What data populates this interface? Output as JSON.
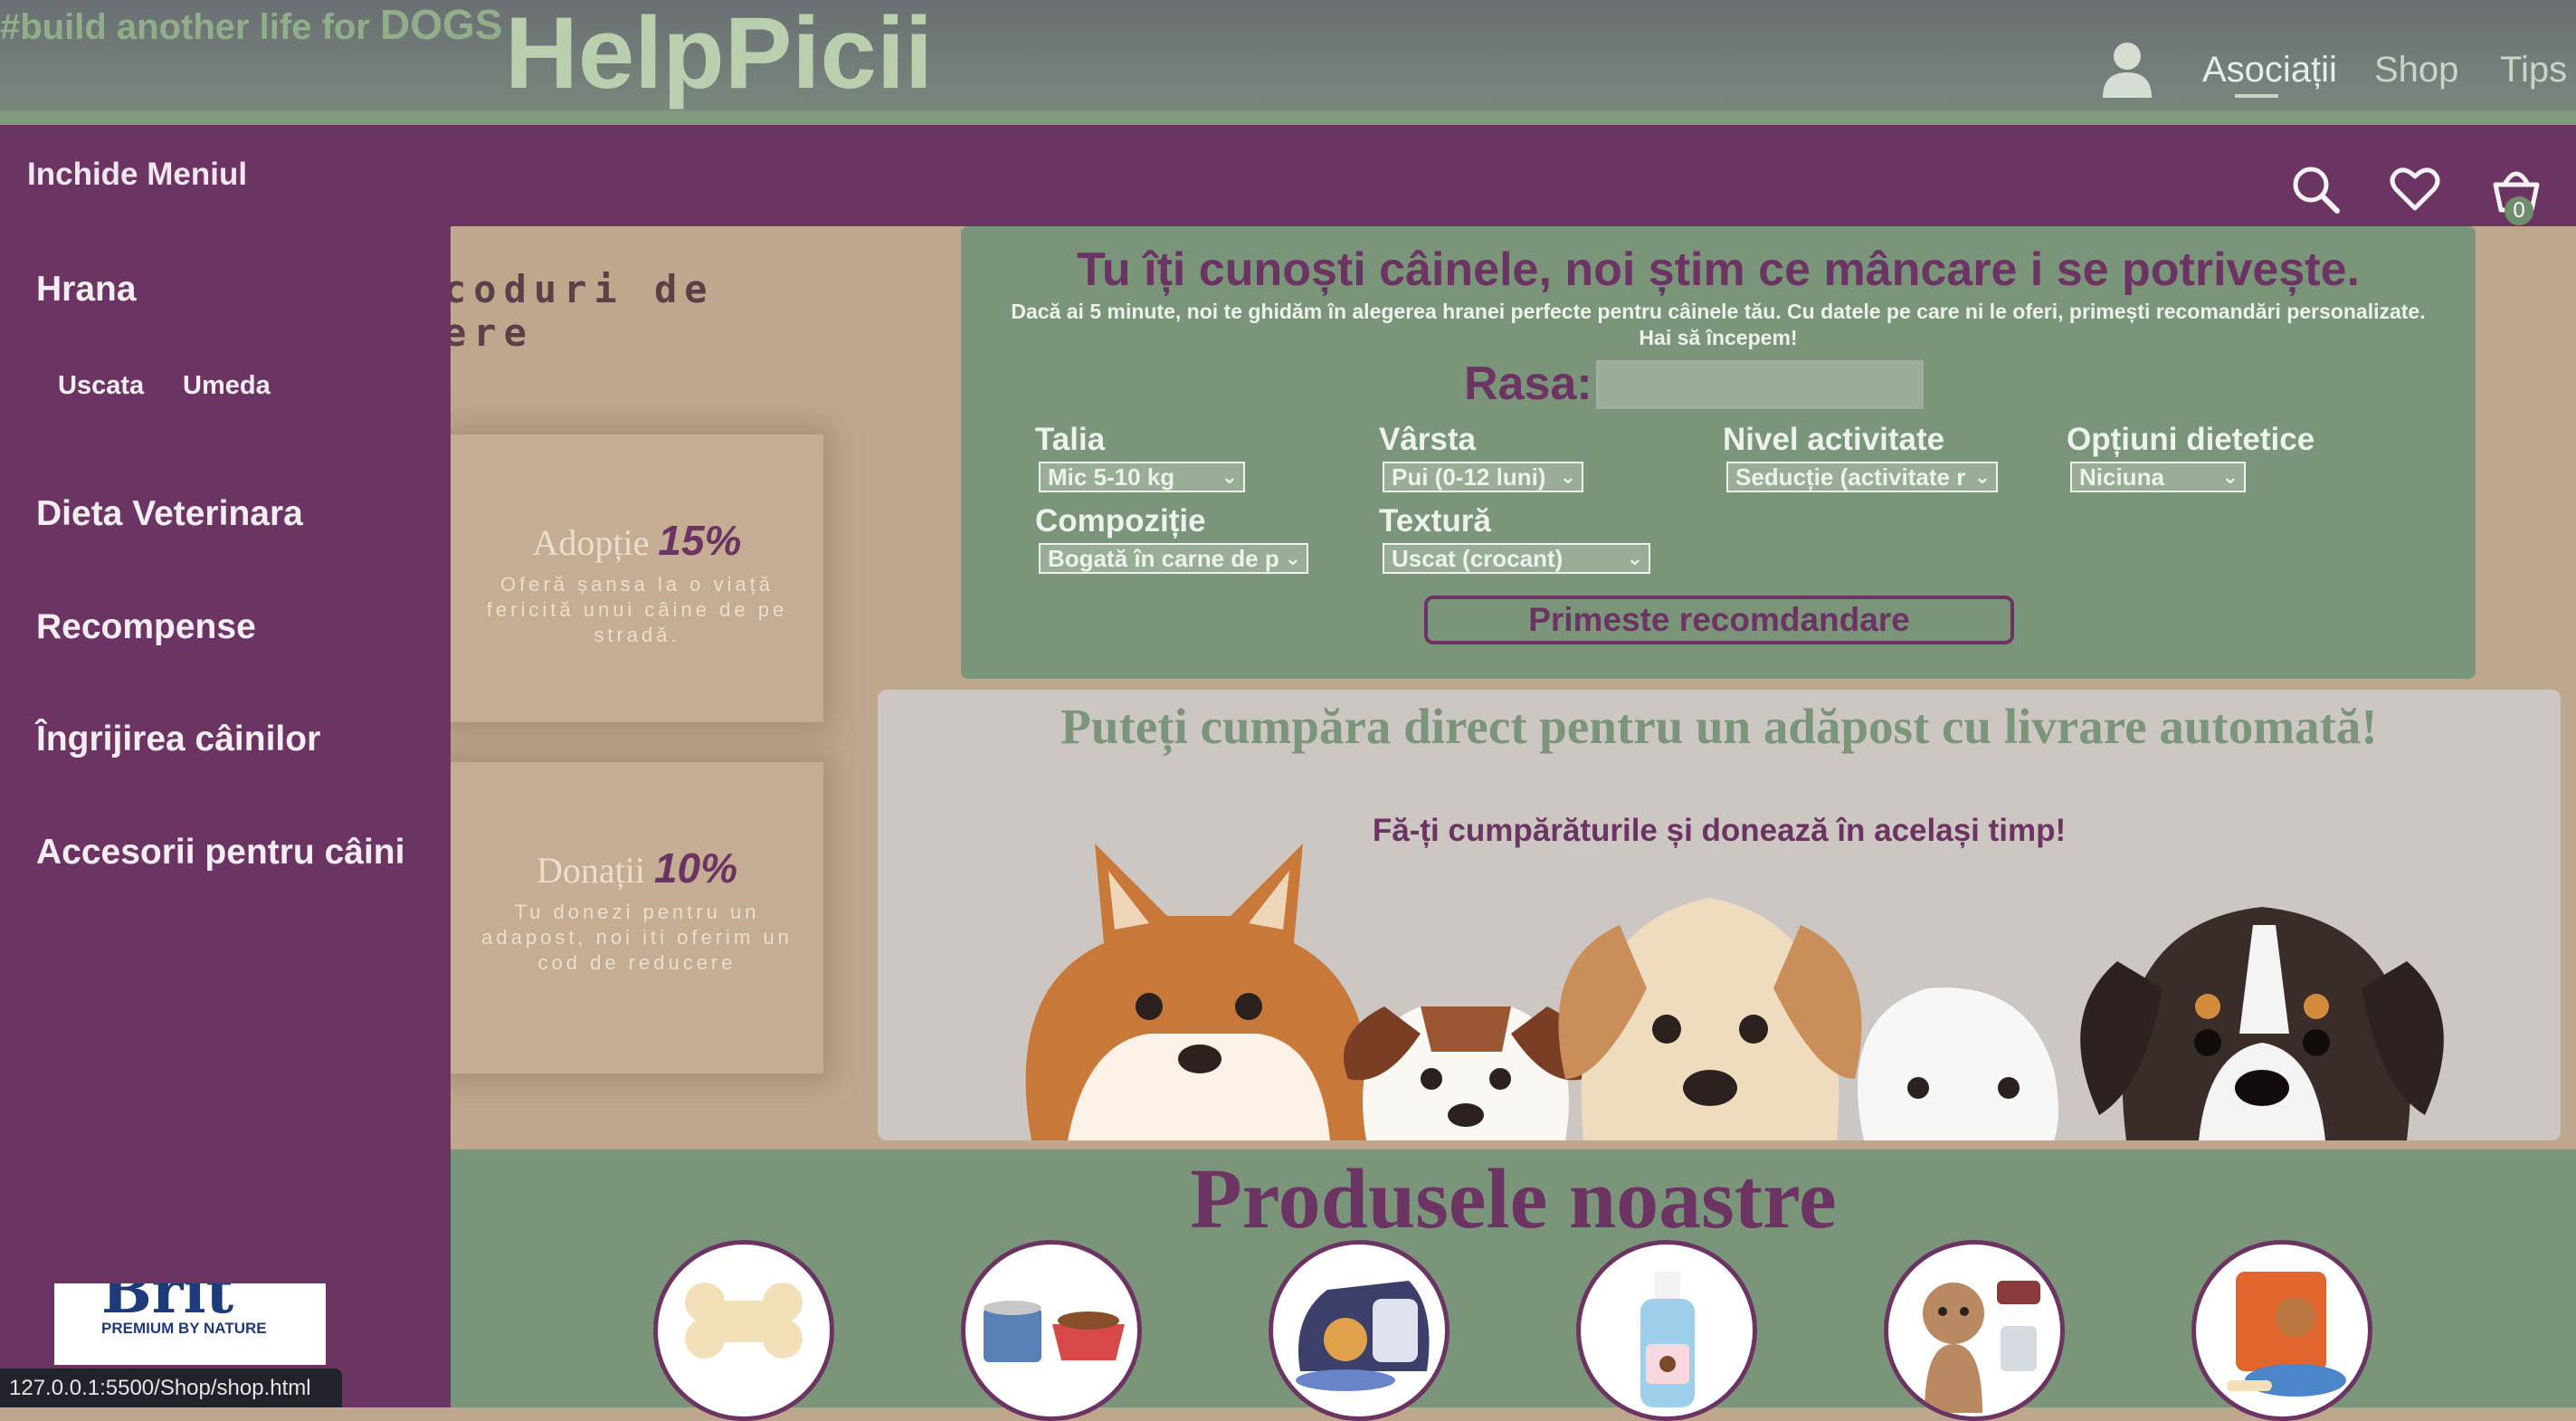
{
  "header": {
    "tagline_prefix": "#build another life for ",
    "tagline_dogs": "DOGS",
    "logo": "HelpPicii",
    "nav": [
      {
        "label": "Asociații"
      },
      {
        "label": "Shop"
      },
      {
        "label": "Tips"
      }
    ],
    "cart_count": "0"
  },
  "sidebar": {
    "close_label": "Inchide Meniul",
    "items": [
      {
        "label": "Hrana"
      },
      {
        "label": "Dieta Veterinara"
      },
      {
        "label": "Recompense"
      },
      {
        "label": "Îngrijirea câinilor"
      },
      {
        "label": "Accesorii pentru câini"
      }
    ],
    "subitems": [
      {
        "label": "Uscata"
      },
      {
        "label": "Umeda"
      }
    ],
    "brand_big": "Brit",
    "brand_small": "PREMIUM BY NATURE",
    "status_url": "127.0.0.1:5500/Shop/shop.html"
  },
  "promos": {
    "heading_line1": "coduri de",
    "heading_line2": "ere",
    "cards": [
      {
        "title": "Adopție",
        "percent": "15%",
        "desc": "Oferă șansa la o viață fericită unui câine de pe stradă."
      },
      {
        "title": "Donații",
        "percent": "10%",
        "desc": "Tu donezi pentru un adapost, noi iti oferim un cod de reducere"
      }
    ]
  },
  "quiz": {
    "title": "Tu îți cunoști câinele, noi știm ce mâncare i se potrivește.",
    "subtitle_line1": "Dacă ai 5 minute, noi te ghidăm în alegerea hranei perfecte pentru câinele tău. Cu datele pe care ni le oferi, primești recomandări personalizate.",
    "subtitle_line2": "Hai să începem!",
    "rasa_label": "Rasa:",
    "rasa_value": "",
    "fields": [
      {
        "label": "Talia",
        "value": "Mic 5-10 kg"
      },
      {
        "label": "Vârsta",
        "value": "Pui (0-12 luni)"
      },
      {
        "label": "Nivel activitate",
        "value": "Seducție (activitate r"
      },
      {
        "label": "Opțiuni dietetice",
        "value": "Niciuna"
      },
      {
        "label": "Compoziție",
        "value": "Bogată în carne de p"
      },
      {
        "label": "Textură",
        "value": "Uscat (crocant)"
      }
    ],
    "button_label": "Primeste recomdandare"
  },
  "banner": {
    "title": "Puteți cumpăra direct pentru un adăpost cu livrare automată!",
    "subtitle": "Fă-ți cumpărăturile și donează în același timp!"
  },
  "products": {
    "title": "Produsele noastre",
    "items": [
      {
        "icon": "bone-icon"
      },
      {
        "icon": "canned-food-icon"
      },
      {
        "icon": "pet-carrier-icon"
      },
      {
        "icon": "shampoo-bottle-icon"
      },
      {
        "icon": "dog-accessories-icon"
      },
      {
        "icon": "dog-food-bag-icon"
      }
    ]
  },
  "colors": {
    "purple": "#6b3462",
    "sage": "#7a957a",
    "tan": "#bfa78e",
    "logo_green": "#b9cfae"
  }
}
